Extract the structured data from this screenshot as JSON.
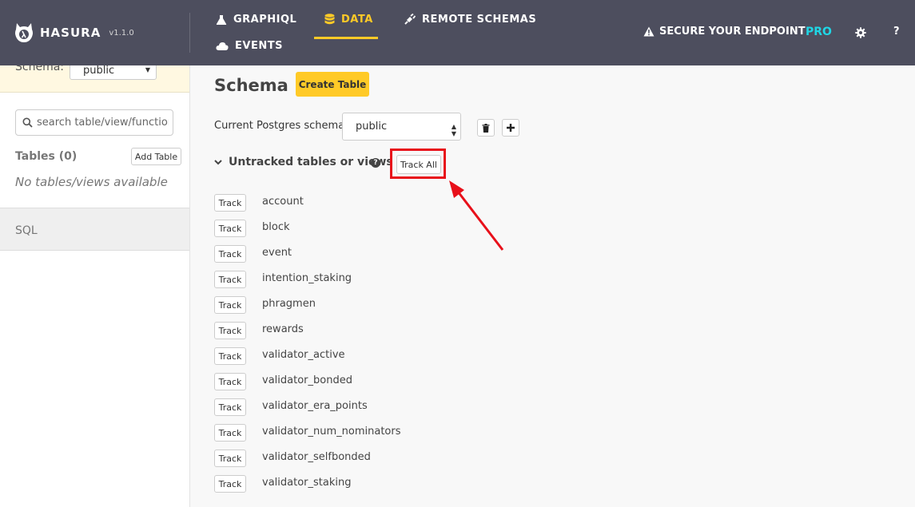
{
  "colors": {
    "navbar": "#4d4e5e",
    "accent": "#ffca27",
    "pro": "#1fd6e5",
    "highlight": "#e8101a"
  },
  "brand": {
    "name": "HASURA",
    "version": "v1.1.0",
    "icon": "hasura-logo-icon"
  },
  "nav": {
    "graphiql": {
      "label": "GRAPHIQL",
      "icon": "flask-icon"
    },
    "data": {
      "label": "DATA",
      "icon": "database-icon",
      "active": true
    },
    "remote_schemas": {
      "label": "REMOTE SCHEMAS",
      "icon": "plug-icon"
    },
    "events": {
      "label": "EVENTS",
      "icon": "cloud-icon"
    }
  },
  "header_right": {
    "secure": {
      "label": "SECURE YOUR ENDPOINT",
      "icon": "warning-icon"
    },
    "pro": "PRO",
    "settings_icon": "gear-icon",
    "help": "?"
  },
  "sidebar": {
    "schema_label": "Schema:",
    "schema_value": "public",
    "search_placeholder": "search table/view/function",
    "tables_heading": "Tables (0)",
    "add_table": "Add Table",
    "empty_message": "No tables/views available",
    "sql_item": "SQL"
  },
  "main": {
    "title": "Schema",
    "create_table": "Create Table",
    "current_schema_label": "Current Postgres schema",
    "current_schema_value": "public",
    "delete_icon": "trash-icon",
    "add_icon": "plus-icon",
    "untracked_heading": "Untracked tables or views",
    "help_icon": "question-icon",
    "track_all": "Track All",
    "track_label": "Track",
    "tables": [
      "account",
      "block",
      "event",
      "intention_staking",
      "phragmen",
      "rewards",
      "validator_active",
      "validator_bonded",
      "validator_era_points",
      "validator_num_nominators",
      "validator_selfbonded",
      "validator_staking"
    ]
  }
}
